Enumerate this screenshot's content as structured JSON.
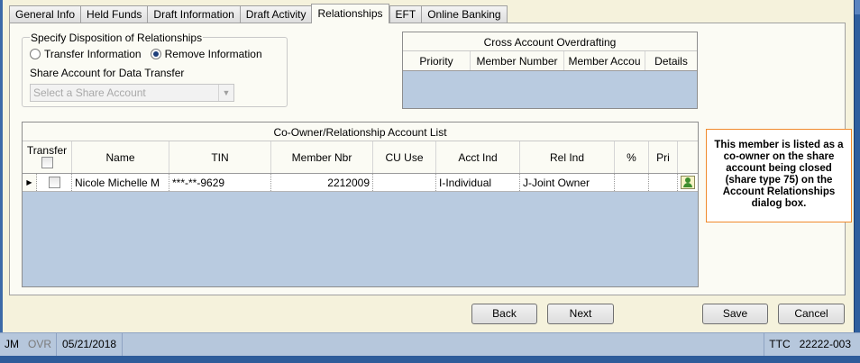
{
  "tabs": [
    {
      "label": "General Info"
    },
    {
      "label": "Held Funds"
    },
    {
      "label": "Draft Information"
    },
    {
      "label": "Draft Activity"
    },
    {
      "label": "Relationships",
      "active": true
    },
    {
      "label": "EFT"
    },
    {
      "label": "Online Banking"
    }
  ],
  "disposition": {
    "title": "Specify Disposition of Relationships",
    "option_transfer": "Transfer Information",
    "option_remove": "Remove Information",
    "selected": "Remove Information",
    "share_label": "Share Account for Data Transfer",
    "share_placeholder": "Select a Share Account"
  },
  "overdraft": {
    "title": "Cross Account Overdrafting",
    "columns": [
      "Priority",
      "Member Number",
      "Member Accou",
      "Details"
    ]
  },
  "coowner": {
    "title": "Co-Owner/Relationship Account List",
    "columns": {
      "transfer": "Transfer",
      "name": "Name",
      "tin": "TIN",
      "member_nbr": "Member Nbr",
      "cu_use": "CU Use",
      "acct_ind": "Acct Ind",
      "rel_ind": "Rel Ind",
      "pct": "%",
      "pri": "Pri"
    },
    "rows": [
      {
        "transfer": false,
        "name": "Nicole Michelle M",
        "tin": "***-**-9629",
        "member_nbr": "2212009",
        "cu_use": "",
        "acct_ind": "I-Individual",
        "rel_ind": "J-Joint Owner",
        "pct": "",
        "pri": ""
      }
    ]
  },
  "callout_text": "This member is listed as a co-owner on the share account being closed (share type 75) on the Account Relationships dialog box.",
  "buttons": {
    "back": "Back",
    "next": "Next",
    "save": "Save",
    "cancel": "Cancel"
  },
  "status": {
    "user": "JM",
    "ovr": "OVR",
    "date": "05/21/2018",
    "ttc_label": "TTC",
    "ttc_value": "22222-003"
  },
  "colors": {
    "window_bg": "#f5f2dc",
    "grid_bg": "#b9cbe0",
    "callout_border": "#f08a2c",
    "frame": "#2e5c9a"
  }
}
